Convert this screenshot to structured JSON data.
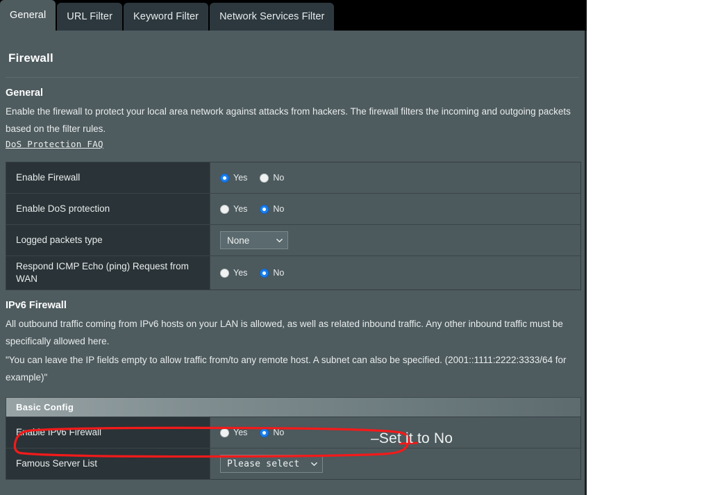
{
  "tabs": [
    {
      "label": "General",
      "active": true
    },
    {
      "label": "URL Filter",
      "active": false
    },
    {
      "label": "Keyword Filter",
      "active": false
    },
    {
      "label": "Network Services Filter",
      "active": false
    }
  ],
  "page": {
    "title": "Firewall"
  },
  "general": {
    "heading": "General",
    "description": "Enable the firewall to protect your local area network against attacks from hackers. The firewall filters the incoming and outgoing packets based on the filter rules.",
    "faq_link": "DoS Protection FAQ",
    "rows": [
      {
        "label": "Enable Firewall",
        "control": "radio",
        "options": [
          "Yes",
          "No"
        ],
        "selected": "Yes"
      },
      {
        "label": "Enable DoS protection",
        "control": "radio",
        "options": [
          "Yes",
          "No"
        ],
        "selected": "No"
      },
      {
        "label": "Logged packets type",
        "control": "select",
        "value": "None"
      },
      {
        "label": "Respond ICMP Echo (ping) Request from WAN",
        "control": "radio",
        "options": [
          "Yes",
          "No"
        ],
        "selected": "No"
      }
    ]
  },
  "ipv6": {
    "heading": "IPv6 Firewall",
    "description_1": "All outbound traffic coming from IPv6 hosts on your LAN is allowed, as well as related inbound traffic. Any other inbound traffic must be specifically allowed here.",
    "description_2": "\"You can leave the IP fields empty to allow traffic from/to any remote host. A subnet can also be specified. (2001::1111:2222:3333/64 for example)\"",
    "banner": "Basic Config",
    "rows": [
      {
        "label": "Enable IPv6 Firewall",
        "control": "radio",
        "options": [
          "Yes",
          "No"
        ],
        "selected": "No"
      },
      {
        "label": "Famous Server List",
        "control": "select",
        "value": "Please select"
      }
    ]
  },
  "annotation": {
    "text": "–Set it to No",
    "color": "#f31a1a"
  }
}
